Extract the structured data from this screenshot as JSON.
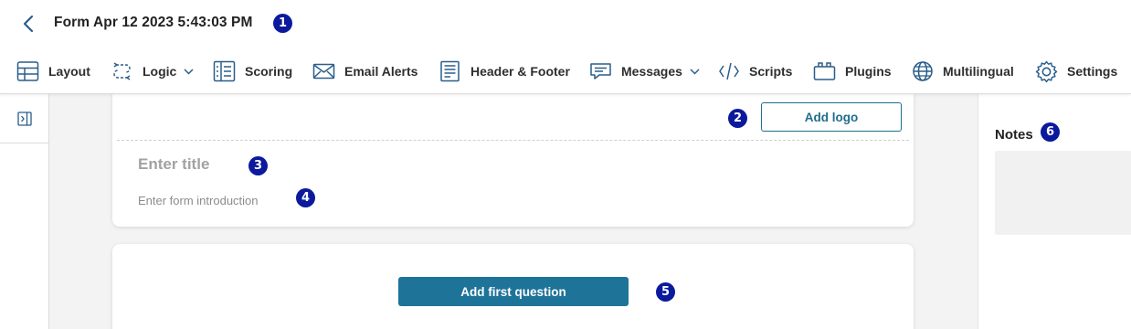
{
  "header": {
    "title": "Form Apr 12 2023 5:43:03 PM"
  },
  "toolbar": {
    "items": [
      {
        "label": "Layout",
        "icon": "layout-icon"
      },
      {
        "label": "Logic",
        "icon": "logic-icon",
        "dropdown": true
      },
      {
        "label": "Scoring",
        "icon": "scoring-icon"
      },
      {
        "label": "Email Alerts",
        "icon": "envelope-icon"
      },
      {
        "label": "Header & Footer",
        "icon": "header-footer-icon"
      },
      {
        "label": "Messages",
        "icon": "chat-bubble-icon",
        "dropdown": true
      },
      {
        "label": "Scripts",
        "icon": "code-icon"
      },
      {
        "label": "Plugins",
        "icon": "plugin-box-icon"
      },
      {
        "label": "Multilingual",
        "icon": "globe-icon"
      },
      {
        "label": "Settings",
        "icon": "gear-icon"
      }
    ]
  },
  "form_header_card": {
    "add_logo_label": "Add logo",
    "title_placeholder": "Enter title",
    "intro_placeholder": "Enter form introduction"
  },
  "questions_card": {
    "add_first_question_label": "Add first question"
  },
  "notes_panel": {
    "label": "Notes"
  },
  "markers": [
    "1",
    "2",
    "3",
    "4",
    "5",
    "6"
  ],
  "colors": {
    "accent": "#1e7399",
    "marker": "#0b1a9c",
    "icon": "#2a5d8a"
  }
}
